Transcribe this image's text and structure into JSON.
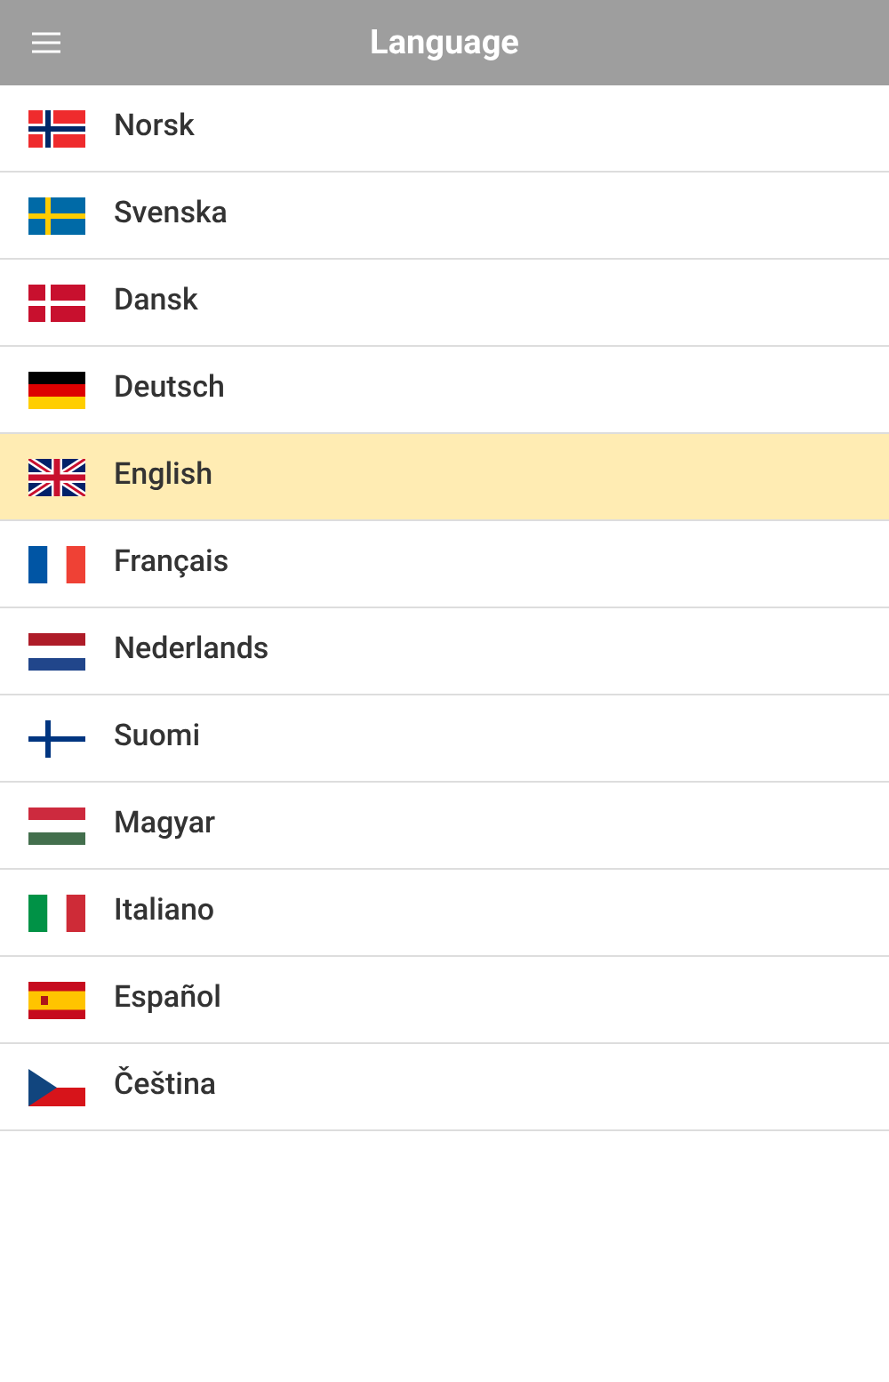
{
  "header": {
    "title": "Language"
  },
  "languages": [
    {
      "label": "Norsk",
      "kind": "no",
      "selected": false
    },
    {
      "label": "Svenska",
      "kind": "se",
      "selected": false
    },
    {
      "label": "Dansk",
      "kind": "dk",
      "selected": false
    },
    {
      "label": "Deutsch",
      "kind": "de",
      "selected": false
    },
    {
      "label": "English",
      "kind": "gb",
      "selected": true
    },
    {
      "label": "Français",
      "kind": "fr",
      "selected": false
    },
    {
      "label": "Nederlands",
      "kind": "nl",
      "selected": false
    },
    {
      "label": "Suomi",
      "kind": "fi",
      "selected": false
    },
    {
      "label": "Magyar",
      "kind": "hu",
      "selected": false
    },
    {
      "label": "Italiano",
      "kind": "it",
      "selected": false
    },
    {
      "label": "Español",
      "kind": "es",
      "selected": false
    },
    {
      "label": "Čeština",
      "kind": "cz",
      "selected": false
    }
  ]
}
